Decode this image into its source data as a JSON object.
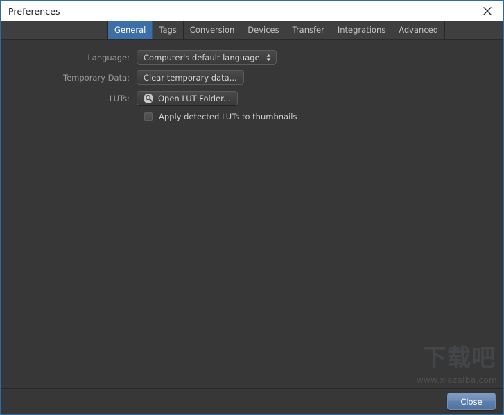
{
  "window": {
    "title": "Preferences",
    "close_icon": "close-icon",
    "accent_color": "#2b6ca3",
    "background_color": "#373737",
    "titlebar_background": "#ffffff"
  },
  "tabs": [
    {
      "label": "General",
      "selected": true
    },
    {
      "label": "Tags",
      "selected": false
    },
    {
      "label": "Conversion",
      "selected": false
    },
    {
      "label": "Devices",
      "selected": false
    },
    {
      "label": "Transfer",
      "selected": false
    },
    {
      "label": "Integrations",
      "selected": false
    },
    {
      "label": "Advanced",
      "selected": false
    }
  ],
  "general": {
    "language": {
      "label": "Language:",
      "value": "Computer's default language",
      "indicator_icon": "chevron-up-down-icon"
    },
    "temporary_data": {
      "label": "Temporary Data:",
      "button_label": "Clear temporary data..."
    },
    "luts": {
      "label": "LUTs:",
      "button_label": "Open LUT Folder...",
      "button_icon": "search-icon"
    },
    "apply_luts_checkbox": {
      "label": "Apply detected LUTs to thumbnails",
      "checked": false
    }
  },
  "footer": {
    "close_label": "Close",
    "close_color": "#6b8cb8"
  },
  "watermark": {
    "logo_text": "下载吧",
    "url_text": "www.xiazaiba.com"
  }
}
